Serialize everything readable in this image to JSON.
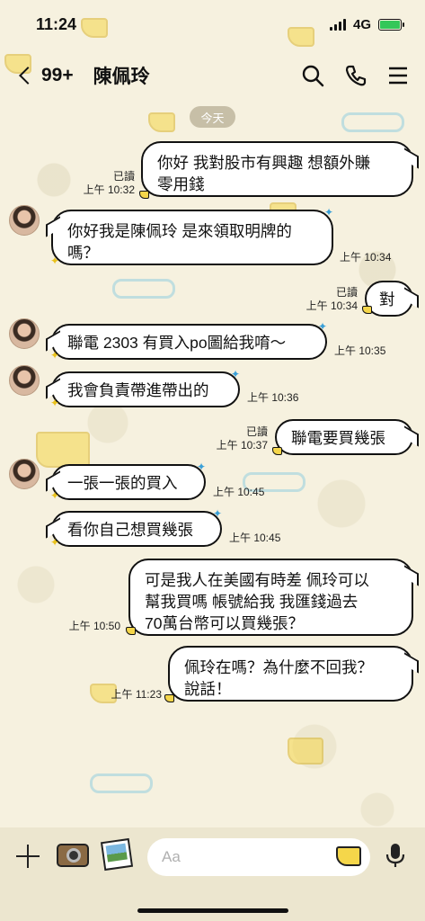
{
  "status_bar": {
    "time": "11:24",
    "network": "4G"
  },
  "nav": {
    "unread_count": "99+",
    "contact_name": "陳佩玲"
  },
  "date_separator": "今天",
  "messages": [
    {
      "side": "out",
      "text": "你好 我對股市有興趣 想額外賺\n零用錢",
      "read": "已讀",
      "time": "上午 10:32"
    },
    {
      "side": "in",
      "text": "你好我是陳佩玲 是來領取明牌的\n嗎？",
      "time": "上午 10:34"
    },
    {
      "side": "out",
      "text": "對",
      "read": "已讀",
      "time": "上午 10:34"
    },
    {
      "side": "in",
      "text": "聯電 2303 有買入po圖給我唷～",
      "time": "上午 10:35"
    },
    {
      "side": "in",
      "text": "我會負責帶進帶出的",
      "time": "上午 10:36"
    },
    {
      "side": "out",
      "text": "聯電要買幾張",
      "read": "已讀",
      "time": "上午 10:37"
    },
    {
      "side": "in",
      "text": "一張一張的買入",
      "time": "上午 10:45"
    },
    {
      "side": "in",
      "text": "看你自己想買幾張",
      "time": "上午 10:45"
    },
    {
      "side": "out",
      "text": "可是我人在美國有時差 佩玲可以\n幫我買嗎 帳號給我 我匯錢過去\n70萬台幣可以買幾張？",
      "time": "上午 10:50"
    },
    {
      "side": "out",
      "text": "佩玲在嗎？為什麼不回我？\n說話！",
      "time": "上午 11:23"
    }
  ],
  "composer": {
    "placeholder": "Aa"
  },
  "icons": [
    "back-chevron-icon",
    "search-icon",
    "phone-icon",
    "menu-icon",
    "plus-icon",
    "camera-icon",
    "photo-icon",
    "sticker-cheese-icon",
    "mic-icon"
  ],
  "colors": {
    "background": "#f6f1df",
    "bubble": "#ffffff",
    "border": "#111111",
    "battery": "#34c759",
    "bottom_bar": "#ece6cf"
  }
}
